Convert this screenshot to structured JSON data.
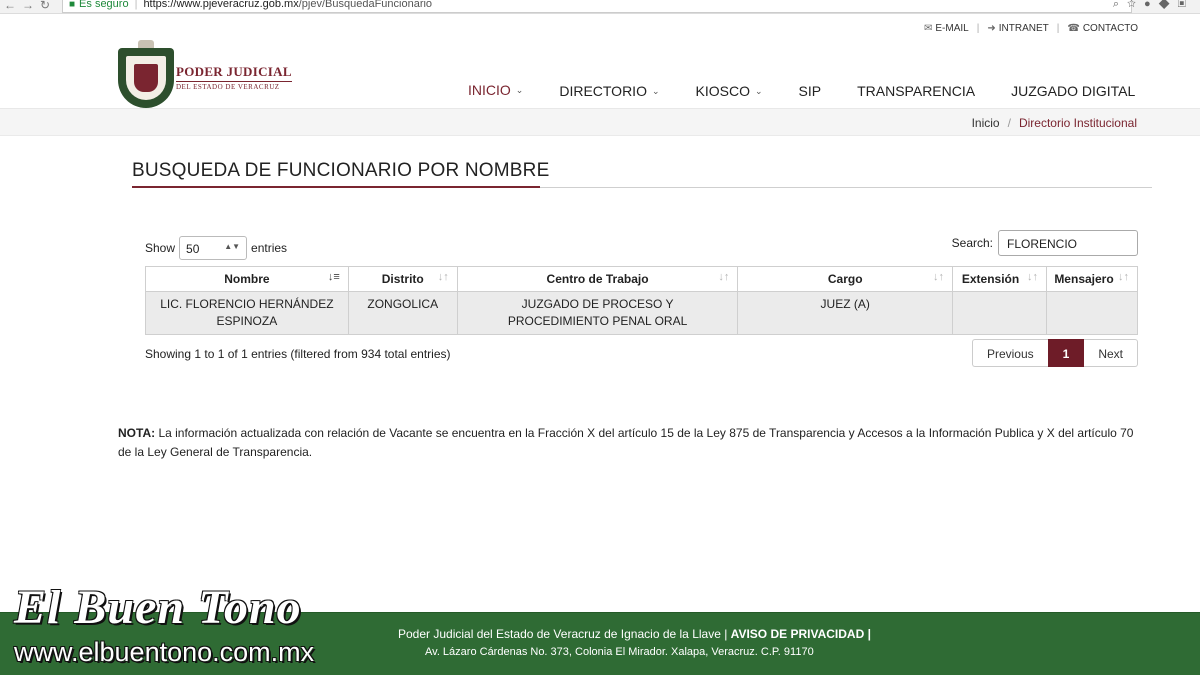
{
  "browser": {
    "secure_label": "Es seguro",
    "url_host": "https://www.pjeveracruz.gob.mx",
    "url_path": "/pjev/BusquedaFuncionario"
  },
  "toplinks": [
    {
      "icon": "envelope-icon",
      "label": "E-MAIL"
    },
    {
      "icon": "login-icon",
      "label": "INTRANET"
    },
    {
      "icon": "phone-icon",
      "label": "CONTACTO"
    }
  ],
  "logo": {
    "line1": "PODER JUDICIAL",
    "line2": "DEL ESTADO DE VERACRUZ"
  },
  "nav": [
    {
      "label": "INICIO",
      "caret": true,
      "active": true
    },
    {
      "label": "DIRECTORIO",
      "caret": true
    },
    {
      "label": "KIOSCO",
      "caret": true
    },
    {
      "label": "SIP",
      "caret": false
    },
    {
      "label": "TRANSPARENCIA",
      "caret": false
    },
    {
      "label": "JUZGADO DIGITAL",
      "caret": false
    }
  ],
  "breadcrumb": {
    "home": "Inicio",
    "separator": "/",
    "current": "Directorio Institucional"
  },
  "page_title": "BUSQUEDA DE FUNCIONARIO POR NOMBRE",
  "table_controls": {
    "show_label": "Show",
    "entries_value": "50",
    "entries_label": "entries",
    "search_label": "Search:",
    "search_value": "FLORENCIO"
  },
  "table": {
    "columns": [
      "Nombre",
      "Distrito",
      "Centro de Trabajo",
      "Cargo",
      "Extensión",
      "Mensajero"
    ],
    "rows": [
      [
        "LIC. FLORENCIO HERNÁNDEZ ESPINOZA",
        "ZONGOLICA",
        "JUZGADO DE PROCESO Y PROCEDIMIENTO PENAL ORAL",
        "JUEZ (A)",
        "",
        ""
      ]
    ]
  },
  "info_text": "Showing 1 to 1 of 1 entries (filtered from 934 total entries)",
  "pagination": {
    "prev": "Previous",
    "current": "1",
    "next": "Next"
  },
  "note": {
    "label": "NOTA:",
    "text": " La información actualizada con relación de Vacante se encuentra en la Fracción X del artículo 15 de la Ley 875 de Transparencia y Accesos a la Información Publica y X del artículo 70 de la Ley General de Transparencia."
  },
  "footer": {
    "line1_normal": "Poder Judicial del Estado de Veracruz de Ignacio de la Llave | ",
    "line1_bold": "AVISO DE PRIVACIDAD |",
    "line2": "Av. Lázaro Cárdenas No. 373, Colonia El Mirador. Xalapa, Veracruz. C.P. 91170"
  },
  "watermark": {
    "title": "El Buen Tono",
    "url": "www.elbuentono.com.mx"
  },
  "colors": {
    "accent": "#7a2530",
    "footer": "#2f6b34",
    "pager_active": "#6e1c28"
  }
}
